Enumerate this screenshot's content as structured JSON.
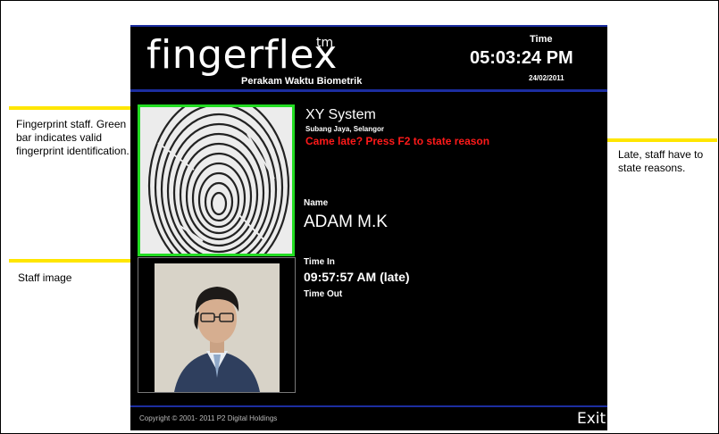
{
  "annotations": {
    "fingerprint_note": "Fingerprint staff. Green bar indicates valid fingerprint identification.",
    "late_note": "Late, staff have to state reasons.",
    "image_note": "Staff image"
  },
  "header": {
    "logo": "fingerflex",
    "trademark": "tm",
    "subtitle": "Perakam Waktu Biometrik",
    "time_label": "Time",
    "time_value": "05:03:24 PM",
    "date_value": "24/02/2011"
  },
  "info": {
    "company": "XY System",
    "location": "Subang Jaya, Selangor",
    "late_message": "Came late? Press F2 to state reason",
    "name_label": "Name",
    "name_value": "ADAM M.K",
    "time_in_label": "Time In",
    "time_in_value": "09:57:57 AM (late)",
    "time_out_label": "Time Out"
  },
  "footer": {
    "copyright": "Copyright © 2001- 2011 P2 Digital Holdings",
    "exit_label": "Exit"
  },
  "colors": {
    "valid_fingerprint": "#22dd22",
    "late_text": "#ff1a1a",
    "accent_bar": "#1c2da0",
    "callout_line": "#ffe600"
  },
  "icons": {
    "fingerprint": "fingerprint-image",
    "staff_photo": "staff-portrait-image"
  }
}
